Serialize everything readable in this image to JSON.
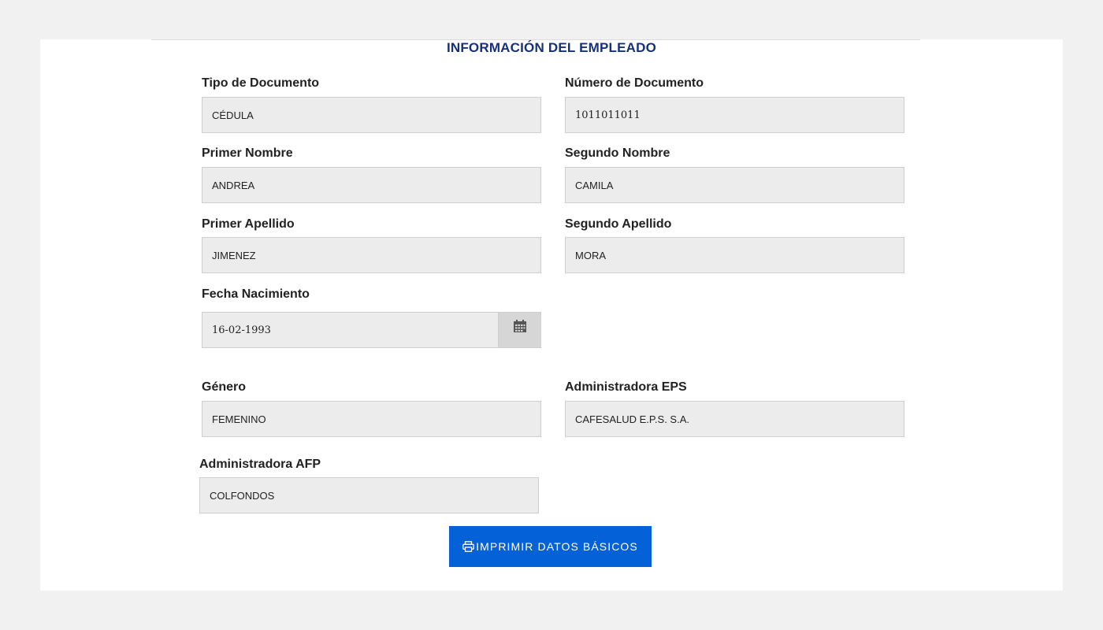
{
  "section": {
    "title": "INFORMACIÓN DEL EMPLEADO"
  },
  "fields": {
    "tipo_documento": {
      "label": "Tipo de Documento",
      "value": "CÉDULA"
    },
    "numero_documento": {
      "label": "Número de Documento",
      "value": "1011011011"
    },
    "primer_nombre": {
      "label": "Primer Nombre",
      "value": "ANDREA"
    },
    "segundo_nombre": {
      "label": "Segundo Nombre",
      "value": "CAMILA"
    },
    "primer_apellido": {
      "label": "Primer Apellido",
      "value": "JIMENEZ"
    },
    "segundo_apellido": {
      "label": "Segundo Apellido",
      "value": "MORA"
    },
    "fecha_nacimiento": {
      "label": "Fecha Nacimiento",
      "value": "16-02-1993"
    },
    "genero": {
      "label": "Género",
      "value": "FEMENINO"
    },
    "eps": {
      "label": "Administradora EPS",
      "value": "CAFESALUD E.P.S. S.A."
    },
    "afp": {
      "label": "Administradora AFP",
      "value": "COLFONDOS"
    }
  },
  "actions": {
    "print_label": "IMPRIMIR DATOS BÁSICOS"
  },
  "icons": {
    "calendar": "calendar-icon",
    "print": "printer-icon"
  },
  "colors": {
    "title": "#17307a",
    "button": "#0561d7",
    "input_bg": "#ececec",
    "page_bg": "#f1f1f1"
  }
}
